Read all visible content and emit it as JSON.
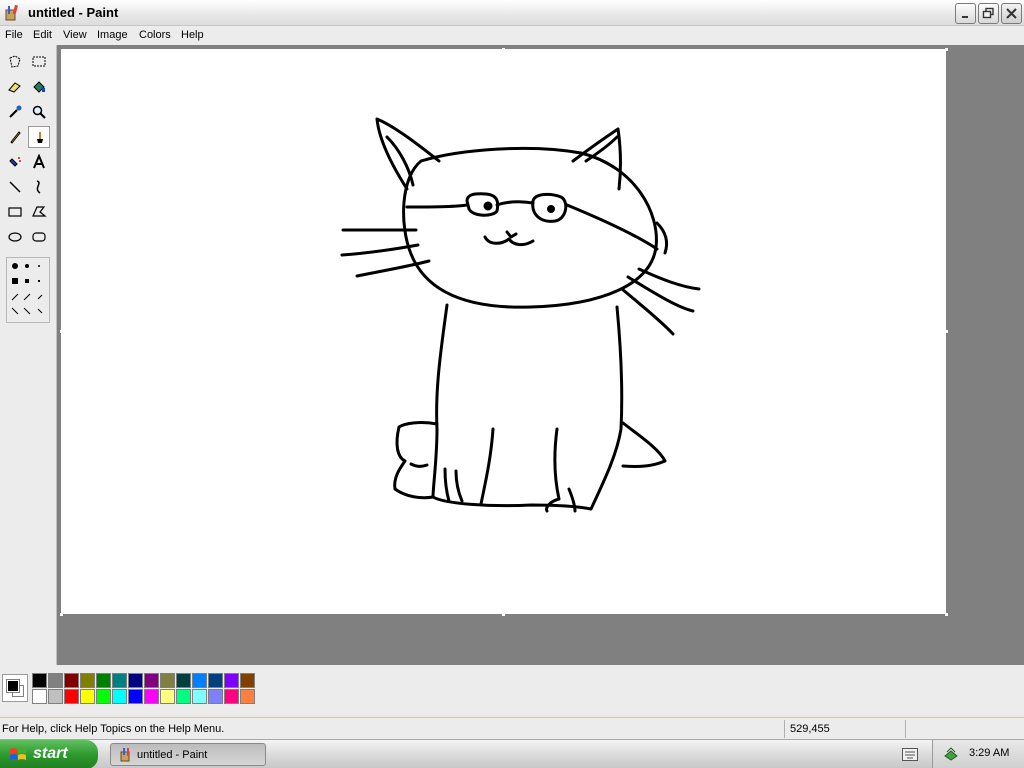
{
  "window": {
    "title": "untitled - Paint"
  },
  "menu": {
    "items": [
      "File",
      "Edit",
      "View",
      "Image",
      "Colors",
      "Help"
    ]
  },
  "tools": [
    "free-form-select",
    "select",
    "eraser",
    "fill-with-color",
    "pick-color",
    "magnifier",
    "pencil",
    "brush",
    "airbrush",
    "text",
    "line",
    "curve",
    "rectangle",
    "polygon",
    "ellipse",
    "rounded-rectangle"
  ],
  "palette": {
    "foreground": "#000000",
    "background": "#ffffff",
    "top_row": [
      "#000000",
      "#808080",
      "#800000",
      "#808000",
      "#008000",
      "#008080",
      "#000080",
      "#800080",
      "#808040",
      "#004040",
      "#0080ff",
      "#004080",
      "#8000ff",
      "#804000"
    ],
    "bottom_row": [
      "#ffffff",
      "#c0c0c0",
      "#ff0000",
      "#ffff00",
      "#00ff00",
      "#00ffff",
      "#0000ff",
      "#ff00ff",
      "#ffff80",
      "#00ff80",
      "#80ffff",
      "#8080ff",
      "#ff0080",
      "#ff8040"
    ]
  },
  "status": {
    "help_text": "For Help, click Help Topics on the Help Menu.",
    "coordinates": "529,455"
  },
  "taskbar": {
    "start_label": "start",
    "task_label": "untitled - Paint",
    "clock": "3:29 AM"
  }
}
